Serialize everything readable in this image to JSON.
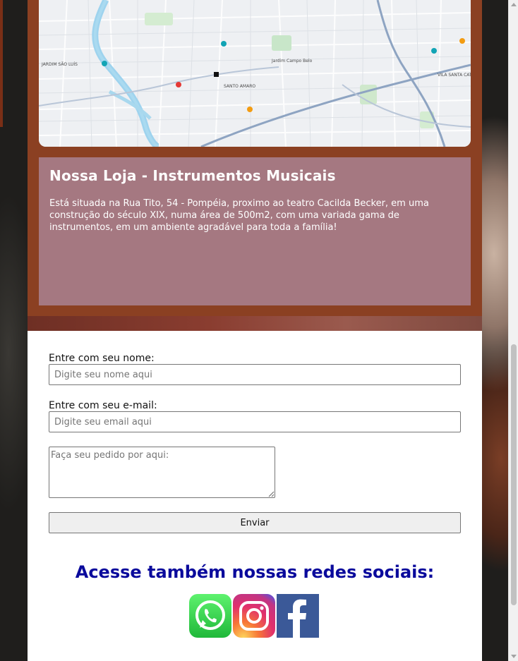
{
  "store": {
    "title": "Nossa Loja - Instrumentos Musicais",
    "description": "Está situada na Rua Tito, 54 - Pompéia, proximo ao teatro Cacilda Becker, em uma construção do século XIX, numa área de 500m2, com uma variada gama de instrumentos, em um ambiente agradável para toda a família!"
  },
  "map": {
    "labels": [
      "SANTO AMARO",
      "Jardim Campo Belo",
      "VILA SANTA CATARINA",
      "JARDIM SÃO LUÍS"
    ]
  },
  "form": {
    "name_label": "Entre com seu nome:",
    "name_placeholder": "Digite seu nome aqui",
    "email_label": "Entre com seu e-mail:",
    "email_placeholder": "Digite seu email aqui",
    "order_placeholder": "Faça seu pedido por aqui:",
    "submit_label": "Enviar"
  },
  "social": {
    "heading": "Acesse também nossas redes sociais:",
    "icons": [
      "whatsapp-icon",
      "instagram-icon",
      "facebook-icon"
    ]
  },
  "colors": {
    "brown_panel": "#8b4022",
    "card_bg": "#a57881",
    "heading_blue": "#0a0a9c"
  }
}
